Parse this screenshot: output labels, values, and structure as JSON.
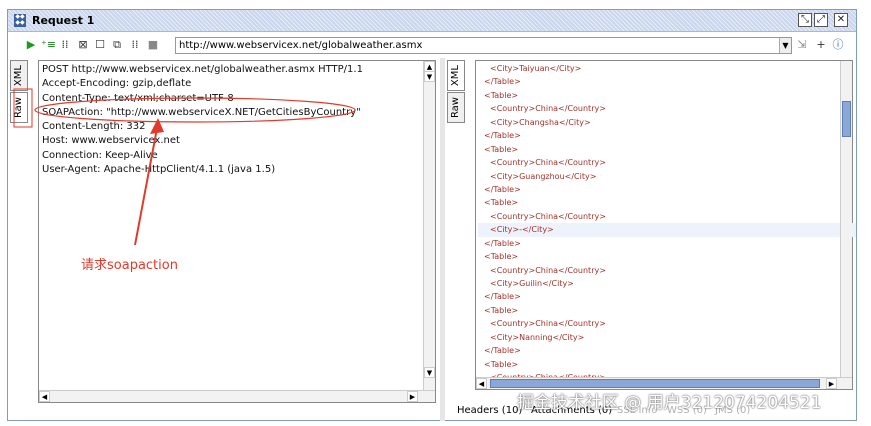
{
  "window": {
    "title": "Request 1"
  },
  "toolbar": {
    "url": "http://www.webservicex.net/globalweather.asmx"
  },
  "left_tabs": [
    {
      "label": "XML"
    },
    {
      "label": "Raw"
    }
  ],
  "right_tabs": [
    {
      "label": "XML"
    },
    {
      "label": "Raw"
    }
  ],
  "raw_request": {
    "lines": [
      "POST http://www.webservicex.net/globalweather.asmx HTTP/1.1",
      "Accept-Encoding: gzip,deflate",
      "Content-Type: text/xml;charset=UTF-8",
      "SOAPAction: \"http://www.webserviceX.NET/GetCitiesByCountry\"",
      "Content-Length: 332",
      "Host: www.webservicex.net",
      "Connection: Keep-Alive",
      "User-Agent: Apache-HttpClient/4.1.1 (java 1.5)"
    ]
  },
  "xml_response": {
    "lines": [
      {
        "indent": 2,
        "text": "<City>Taiyuan</City>"
      },
      {
        "indent": 1,
        "text": "</Table>"
      },
      {
        "indent": 1,
        "text": "<Table>"
      },
      {
        "indent": 2,
        "text": "<Country>China</Country>"
      },
      {
        "indent": 2,
        "text": "<City>Changsha</City>"
      },
      {
        "indent": 1,
        "text": "</Table>"
      },
      {
        "indent": 1,
        "text": "<Table>"
      },
      {
        "indent": 2,
        "text": "<Country>China</Country>"
      },
      {
        "indent": 2,
        "text": "<City>Guangzhou</City>"
      },
      {
        "indent": 1,
        "text": "</Table>"
      },
      {
        "indent": 1,
        "text": "<Table>"
      },
      {
        "indent": 2,
        "text": "<Country>China</Country>"
      },
      {
        "indent": 2,
        "text": "<City>-</City>",
        "highlight": true
      },
      {
        "indent": 1,
        "text": "</Table>"
      },
      {
        "indent": 1,
        "text": "<Table>"
      },
      {
        "indent": 2,
        "text": "<Country>China</Country>"
      },
      {
        "indent": 2,
        "text": "<City>Guilin</City>"
      },
      {
        "indent": 1,
        "text": "</Table>"
      },
      {
        "indent": 1,
        "text": "<Table>"
      },
      {
        "indent": 2,
        "text": "<Country>China</Country>"
      },
      {
        "indent": 2,
        "text": "<City>Nanning</City>"
      },
      {
        "indent": 1,
        "text": "</Table>"
      },
      {
        "indent": 1,
        "text": "<Table>"
      },
      {
        "indent": 2,
        "text": "<Country>China</Country>"
      }
    ]
  },
  "bottom_tabs": [
    {
      "label": "Headers (10)",
      "dim": false
    },
    {
      "label": "Attachments (0)",
      "dim": false
    },
    {
      "label": "SSL Info",
      "dim": true
    },
    {
      "label": "WSS (0)",
      "dim": true
    },
    {
      "label": "JMS (0)",
      "dim": true
    }
  ],
  "annotation": {
    "label": "请求soapaction",
    "color": "#e23a2a"
  },
  "watermark": {
    "text": "掘金技术社区 @ 用户3212074204521"
  }
}
